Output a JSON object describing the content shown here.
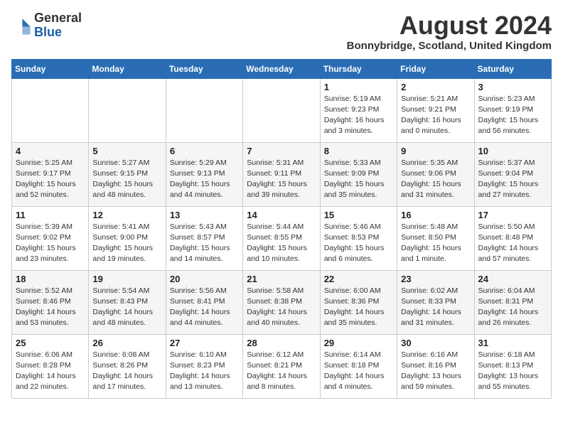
{
  "header": {
    "logo_general": "General",
    "logo_blue": "Blue",
    "month_title": "August 2024",
    "location": "Bonnybridge, Scotland, United Kingdom"
  },
  "weekdays": [
    "Sunday",
    "Monday",
    "Tuesday",
    "Wednesday",
    "Thursday",
    "Friday",
    "Saturday"
  ],
  "weeks": [
    [
      {
        "day": "",
        "info": ""
      },
      {
        "day": "",
        "info": ""
      },
      {
        "day": "",
        "info": ""
      },
      {
        "day": "",
        "info": ""
      },
      {
        "day": "1",
        "info": "Sunrise: 5:19 AM\nSunset: 9:23 PM\nDaylight: 16 hours\nand 3 minutes."
      },
      {
        "day": "2",
        "info": "Sunrise: 5:21 AM\nSunset: 9:21 PM\nDaylight: 16 hours\nand 0 minutes."
      },
      {
        "day": "3",
        "info": "Sunrise: 5:23 AM\nSunset: 9:19 PM\nDaylight: 15 hours\nand 56 minutes."
      }
    ],
    [
      {
        "day": "4",
        "info": "Sunrise: 5:25 AM\nSunset: 9:17 PM\nDaylight: 15 hours\nand 52 minutes."
      },
      {
        "day": "5",
        "info": "Sunrise: 5:27 AM\nSunset: 9:15 PM\nDaylight: 15 hours\nand 48 minutes."
      },
      {
        "day": "6",
        "info": "Sunrise: 5:29 AM\nSunset: 9:13 PM\nDaylight: 15 hours\nand 44 minutes."
      },
      {
        "day": "7",
        "info": "Sunrise: 5:31 AM\nSunset: 9:11 PM\nDaylight: 15 hours\nand 39 minutes."
      },
      {
        "day": "8",
        "info": "Sunrise: 5:33 AM\nSunset: 9:09 PM\nDaylight: 15 hours\nand 35 minutes."
      },
      {
        "day": "9",
        "info": "Sunrise: 5:35 AM\nSunset: 9:06 PM\nDaylight: 15 hours\nand 31 minutes."
      },
      {
        "day": "10",
        "info": "Sunrise: 5:37 AM\nSunset: 9:04 PM\nDaylight: 15 hours\nand 27 minutes."
      }
    ],
    [
      {
        "day": "11",
        "info": "Sunrise: 5:39 AM\nSunset: 9:02 PM\nDaylight: 15 hours\nand 23 minutes."
      },
      {
        "day": "12",
        "info": "Sunrise: 5:41 AM\nSunset: 9:00 PM\nDaylight: 15 hours\nand 19 minutes."
      },
      {
        "day": "13",
        "info": "Sunrise: 5:43 AM\nSunset: 8:57 PM\nDaylight: 15 hours\nand 14 minutes."
      },
      {
        "day": "14",
        "info": "Sunrise: 5:44 AM\nSunset: 8:55 PM\nDaylight: 15 hours\nand 10 minutes."
      },
      {
        "day": "15",
        "info": "Sunrise: 5:46 AM\nSunset: 8:53 PM\nDaylight: 15 hours\nand 6 minutes."
      },
      {
        "day": "16",
        "info": "Sunrise: 5:48 AM\nSunset: 8:50 PM\nDaylight: 15 hours\nand 1 minute."
      },
      {
        "day": "17",
        "info": "Sunrise: 5:50 AM\nSunset: 8:48 PM\nDaylight: 14 hours\nand 57 minutes."
      }
    ],
    [
      {
        "day": "18",
        "info": "Sunrise: 5:52 AM\nSunset: 8:46 PM\nDaylight: 14 hours\nand 53 minutes."
      },
      {
        "day": "19",
        "info": "Sunrise: 5:54 AM\nSunset: 8:43 PM\nDaylight: 14 hours\nand 48 minutes."
      },
      {
        "day": "20",
        "info": "Sunrise: 5:56 AM\nSunset: 8:41 PM\nDaylight: 14 hours\nand 44 minutes."
      },
      {
        "day": "21",
        "info": "Sunrise: 5:58 AM\nSunset: 8:38 PM\nDaylight: 14 hours\nand 40 minutes."
      },
      {
        "day": "22",
        "info": "Sunrise: 6:00 AM\nSunset: 8:36 PM\nDaylight: 14 hours\nand 35 minutes."
      },
      {
        "day": "23",
        "info": "Sunrise: 6:02 AM\nSunset: 8:33 PM\nDaylight: 14 hours\nand 31 minutes."
      },
      {
        "day": "24",
        "info": "Sunrise: 6:04 AM\nSunset: 8:31 PM\nDaylight: 14 hours\nand 26 minutes."
      }
    ],
    [
      {
        "day": "25",
        "info": "Sunrise: 6:06 AM\nSunset: 8:28 PM\nDaylight: 14 hours\nand 22 minutes."
      },
      {
        "day": "26",
        "info": "Sunrise: 6:08 AM\nSunset: 8:26 PM\nDaylight: 14 hours\nand 17 minutes."
      },
      {
        "day": "27",
        "info": "Sunrise: 6:10 AM\nSunset: 8:23 PM\nDaylight: 14 hours\nand 13 minutes."
      },
      {
        "day": "28",
        "info": "Sunrise: 6:12 AM\nSunset: 8:21 PM\nDaylight: 14 hours\nand 8 minutes."
      },
      {
        "day": "29",
        "info": "Sunrise: 6:14 AM\nSunset: 8:18 PM\nDaylight: 14 hours\nand 4 minutes."
      },
      {
        "day": "30",
        "info": "Sunrise: 6:16 AM\nSunset: 8:16 PM\nDaylight: 13 hours\nand 59 minutes."
      },
      {
        "day": "31",
        "info": "Sunrise: 6:18 AM\nSunset: 8:13 PM\nDaylight: 13 hours\nand 55 minutes."
      }
    ]
  ]
}
